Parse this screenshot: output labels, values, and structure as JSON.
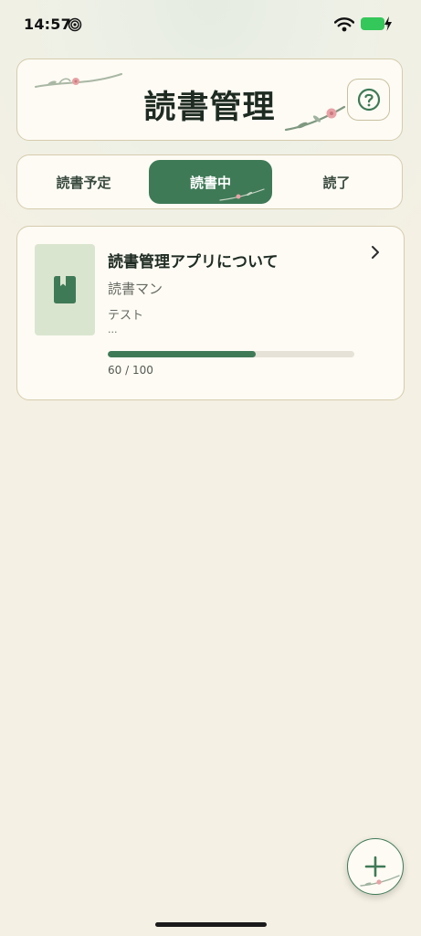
{
  "status_bar": {
    "time": "14:57"
  },
  "header": {
    "title": "読書管理"
  },
  "tabs": [
    {
      "label": "読書予定"
    },
    {
      "label": "読書中"
    },
    {
      "label": "読了"
    }
  ],
  "active_tab": "読書中",
  "book": {
    "title": "読書管理アプリについて",
    "author": "読書マン",
    "note": "テスト",
    "note_more": "...",
    "progress_text": "60 / 100",
    "progress": 0.6
  },
  "colors": {
    "accent": "#3f7a57",
    "background": "#f4f0e3",
    "card": "#fdfbf4",
    "border": "#d6ccae",
    "cover": "#dae5cf",
    "blossom": "#e8a2a6"
  },
  "icons": {
    "help": "question-circle-icon",
    "chevron": "chevron-right-icon",
    "book": "bookmark-book-icon",
    "fab": "plus-icon"
  }
}
